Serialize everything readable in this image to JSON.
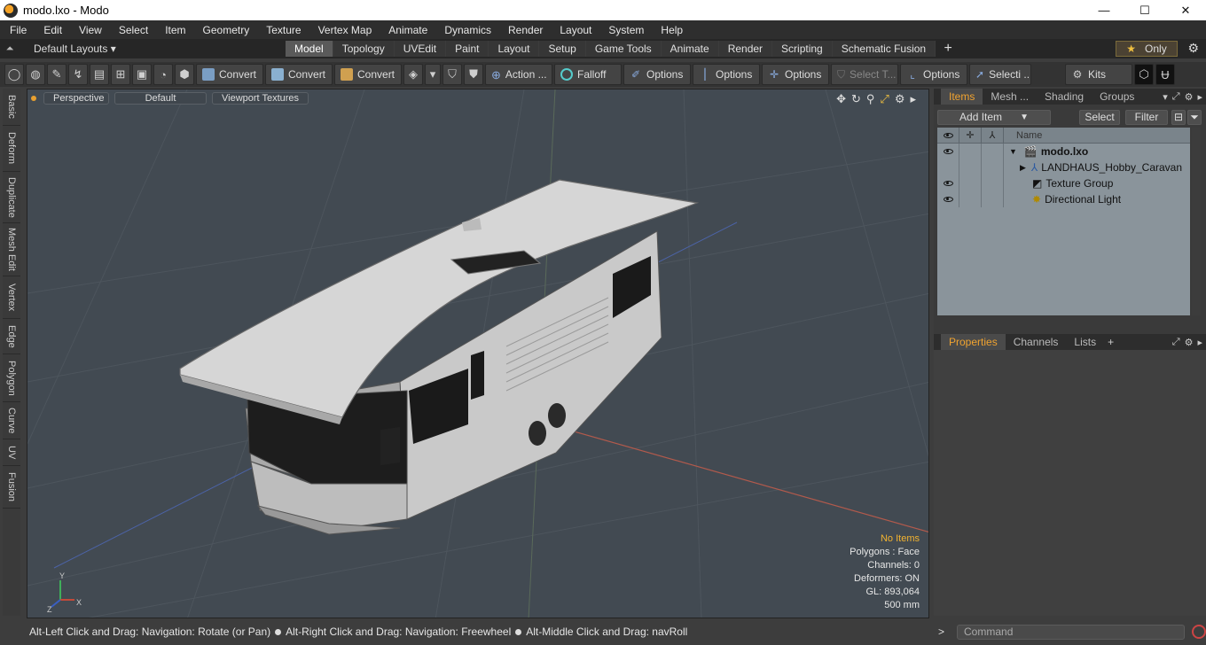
{
  "window": {
    "title": "modo.lxo - Modo",
    "min": "—",
    "max": "☐",
    "close": "✕"
  },
  "menu": [
    "File",
    "Edit",
    "View",
    "Select",
    "Item",
    "Geometry",
    "Texture",
    "Vertex Map",
    "Animate",
    "Dynamics",
    "Render",
    "Layout",
    "System",
    "Help"
  ],
  "layouts": {
    "label": "Default Layouts ▾",
    "up_arrow": "⏶"
  },
  "layout_tabs": [
    "Model",
    "Topology",
    "UVEdit",
    "Paint",
    "Layout",
    "Setup",
    "Game Tools",
    "Animate",
    "Render",
    "Scripting",
    "Schematic Fusion"
  ],
  "active_layout_tab": "Model",
  "add_tab": "+",
  "only": {
    "star": "★",
    "label": "Only"
  },
  "settings_glyph": "⚙",
  "toolbar": {
    "convert1": "Convert",
    "convert2": "Convert",
    "convert3": "Convert",
    "action": "Action ...",
    "falloff": "Falloff",
    "options1": "Options",
    "options2": "Options",
    "options3": "Options",
    "select_t": "Select T...",
    "options4": "Options",
    "selecti": "Selecti ...",
    "kits": "Kits"
  },
  "side_tabs": [
    "Basic",
    "Deform",
    "Duplicate",
    "Mesh Edit",
    "Vertex",
    "Edge",
    "Polygon",
    "Curve",
    "UV",
    "Fusion"
  ],
  "viewport": {
    "view": "Perspective",
    "shading": "Default",
    "textures": "Viewport Textures",
    "stats": {
      "items": "No Items",
      "polygons": "Polygons : Face",
      "channels": "Channels: 0",
      "deformers": "Deformers: ON",
      "gl": "GL: 893,064",
      "scale": "500 mm"
    }
  },
  "status": {
    "hint1": "Alt-Left Click and Drag: Navigation: Rotate (or Pan)",
    "hint2": "Alt-Right Click and Drag: Navigation: Freewheel",
    "hint3": "Alt-Middle Click and Drag: navRoll"
  },
  "items_panel": {
    "tabs": [
      "Items",
      "Mesh ...",
      "Shading",
      "Groups"
    ],
    "add_item": "Add Item",
    "select": "Select",
    "filter": "Filter",
    "column_name": "Name",
    "rows": [
      {
        "name": "modo.lxo",
        "eye": true
      },
      {
        "name": "LANDHAUS_Hobby_Caravan",
        "eye": false
      },
      {
        "name": "Texture Group",
        "eye": true
      },
      {
        "name": "Directional Light",
        "eye": true
      }
    ]
  },
  "props_panel": {
    "tabs": [
      "Properties",
      "Channels",
      "Lists"
    ],
    "add": "+"
  },
  "command": {
    "prompt": ">",
    "placeholder": "Command"
  },
  "colors": {
    "accent": "#f0a330",
    "viewport_bg": "#424a52",
    "list_bg": "#8a949b"
  }
}
